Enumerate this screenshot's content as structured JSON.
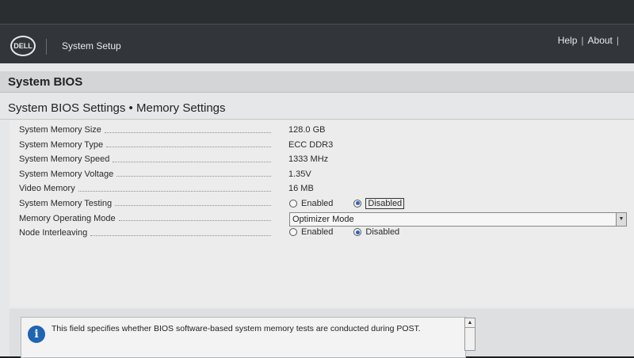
{
  "header": {
    "logo": "DELL",
    "app_title": "System Setup",
    "help_label": "Help",
    "separator": "|",
    "about_label": "About",
    "tail_label": "|"
  },
  "section": {
    "title": "System BIOS"
  },
  "page": {
    "subtitle": "System BIOS Settings • Memory Settings"
  },
  "fields": [
    {
      "label": "System Memory Size",
      "value": "128.0 GB"
    },
    {
      "label": "System Memory Type",
      "value": "ECC DDR3"
    },
    {
      "label": "System Memory Speed",
      "value": "1333 MHz"
    },
    {
      "label": "System Memory Voltage",
      "value": "1.35V"
    },
    {
      "label": "Video Memory",
      "value": "16 MB"
    }
  ],
  "memory_testing": {
    "label": "System Memory Testing",
    "options": [
      "Enabled",
      "Disabled"
    ],
    "selected": "Disabled"
  },
  "operating_mode": {
    "label": "Memory Operating Mode",
    "value": "Optimizer Mode"
  },
  "node_interleaving": {
    "label": "Node Interleaving",
    "options": [
      "Enabled",
      "Disabled"
    ],
    "selected": "Disabled"
  },
  "help": {
    "text": "This field specifies whether BIOS software-based system memory tests are conducted during POST.",
    "icon": "i"
  },
  "icons": {
    "info": "info-icon",
    "dropdown": "chevron-down-icon",
    "scroll_up": "scroll-up-icon"
  },
  "colors": {
    "accent": "#2a63c6",
    "header": "#32363a",
    "info": "#1f64b5"
  }
}
